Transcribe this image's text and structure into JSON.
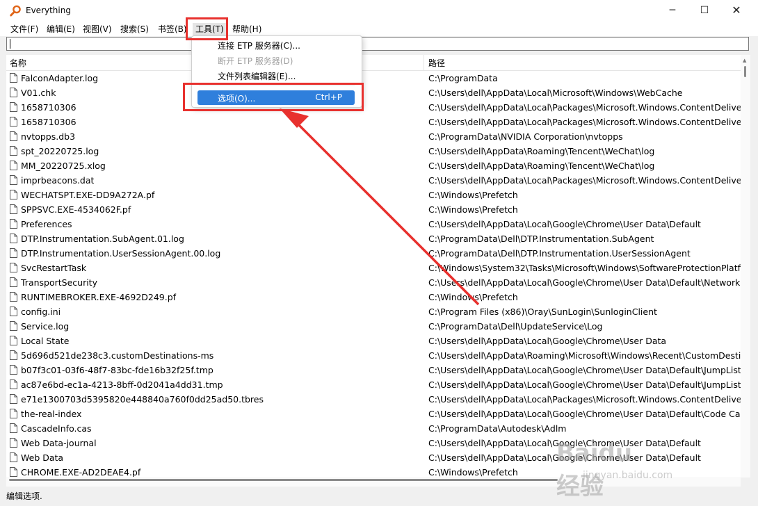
{
  "window": {
    "title": "Everything",
    "minimize": "─",
    "maximize": "☐",
    "close": "✕"
  },
  "menu": [
    {
      "label": "文件(F)"
    },
    {
      "label": "编辑(E)"
    },
    {
      "label": "视图(V)"
    },
    {
      "label": "搜索(S)"
    },
    {
      "label": "书签(B)"
    },
    {
      "label": "工具(T)"
    },
    {
      "label": "帮助(H)"
    }
  ],
  "search": {
    "value": ""
  },
  "columns": {
    "name": "名称",
    "path": "路径"
  },
  "files": [
    {
      "name": "FalconAdapter.log",
      "path": "C:\\ProgramData"
    },
    {
      "name": "V01.chk",
      "path": "C:\\Users\\dell\\AppData\\Local\\Microsoft\\Windows\\WebCache"
    },
    {
      "name": "1658710306",
      "path": "C:\\Users\\dell\\AppData\\Local\\Packages\\Microsoft.Windows.ContentDeliveryM"
    },
    {
      "name": "1658710306",
      "path": "C:\\Users\\dell\\AppData\\Local\\Packages\\Microsoft.Windows.ContentDeliveryM"
    },
    {
      "name": "nvtopps.db3",
      "path": "C:\\ProgramData\\NVIDIA Corporation\\nvtopps"
    },
    {
      "name": "spt_20220725.log",
      "path": "C:\\Users\\dell\\AppData\\Roaming\\Tencent\\WeChat\\log"
    },
    {
      "name": "MM_20220725.xlog",
      "path": "C:\\Users\\dell\\AppData\\Roaming\\Tencent\\WeChat\\log"
    },
    {
      "name": "imprbeacons.dat",
      "path": "C:\\Users\\dell\\AppData\\Local\\Packages\\Microsoft.Windows.ContentDeliveryM"
    },
    {
      "name": "WECHATSPT.EXE-DD9A272A.pf",
      "path": "C:\\Windows\\Prefetch"
    },
    {
      "name": "SPPSVC.EXE-4534062F.pf",
      "path": "C:\\Windows\\Prefetch"
    },
    {
      "name": "Preferences",
      "path": "C:\\Users\\dell\\AppData\\Local\\Google\\Chrome\\User Data\\Default"
    },
    {
      "name": "DTP.Instrumentation.SubAgent.01.log",
      "path": "C:\\ProgramData\\Dell\\DTP.Instrumentation.SubAgent"
    },
    {
      "name": "DTP.Instrumentation.UserSessionAgent.00.log",
      "path": "C:\\ProgramData\\Dell\\DTP.Instrumentation.UserSessionAgent"
    },
    {
      "name": "SvcRestartTask",
      "path": "C:\\Windows\\System32\\Tasks\\Microsoft\\Windows\\SoftwareProtectionPlatform"
    },
    {
      "name": "TransportSecurity",
      "path": "C:\\Users\\dell\\AppData\\Local\\Google\\Chrome\\User Data\\Default\\Network"
    },
    {
      "name": "RUNTIMEBROKER.EXE-4692D249.pf",
      "path": "C:\\Windows\\Prefetch"
    },
    {
      "name": "config.ini",
      "path": "C:\\Program Files (x86)\\Oray\\SunLogin\\SunloginClient"
    },
    {
      "name": "Service.log",
      "path": "C:\\ProgramData\\Dell\\UpdateService\\Log"
    },
    {
      "name": "Local State",
      "path": "C:\\Users\\dell\\AppData\\Local\\Google\\Chrome\\User Data"
    },
    {
      "name": "5d696d521de238c3.customDestinations-ms",
      "path": "C:\\Users\\dell\\AppData\\Roaming\\Microsoft\\Windows\\Recent\\CustomDestinati"
    },
    {
      "name": "b07f3c01-03f6-48f7-83bc-fde16b32f25f.tmp",
      "path": "C:\\Users\\dell\\AppData\\Local\\Google\\Chrome\\User Data\\Default\\JumpListIcon"
    },
    {
      "name": "ac87e6bd-ec1a-4213-8bff-0d2041a4dd31.tmp",
      "path": "C:\\Users\\dell\\AppData\\Local\\Google\\Chrome\\User Data\\Default\\JumpListIcon"
    },
    {
      "name": "e71e1300703d5395820e448840a760f0dd25ad50.tbres",
      "path": "C:\\Users\\dell\\AppData\\Local\\Packages\\Microsoft.Windows.ContentDeliveryM"
    },
    {
      "name": "the-real-index",
      "path": "C:\\Users\\dell\\AppData\\Local\\Google\\Chrome\\User Data\\Default\\Code Cache"
    },
    {
      "name": "CascadeInfo.cas",
      "path": "C:\\ProgramData\\Autodesk\\Adlm"
    },
    {
      "name": "Web Data-journal",
      "path": "C:\\Users\\dell\\AppData\\Local\\Google\\Chrome\\User Data\\Default"
    },
    {
      "name": "Web Data",
      "path": "C:\\Users\\dell\\AppData\\Local\\Google\\Chrome\\User Data\\Default"
    },
    {
      "name": "CHROME.EXE-AD2DEAE4.pf",
      "path": "C:\\Windows\\Prefetch"
    }
  ],
  "tools_menu": {
    "items": [
      {
        "label": "连接 ETP 服务器(C)...",
        "shortcut": "",
        "disabled": false
      },
      {
        "label": "断开 ETP 服务器(D)",
        "shortcut": "",
        "disabled": true
      },
      {
        "label": "文件列表编辑器(E)...",
        "shortcut": "",
        "disabled": false
      },
      {
        "label": "选项(O)...",
        "shortcut": "Ctrl+P",
        "disabled": false
      }
    ]
  },
  "status": {
    "text": "编辑选项."
  },
  "watermark": {
    "logo": "Baidu经验",
    "sub": "jingyan.baidu.com"
  },
  "colors": {
    "annotation": "#e8312e",
    "selection": "#2f7fdc"
  }
}
